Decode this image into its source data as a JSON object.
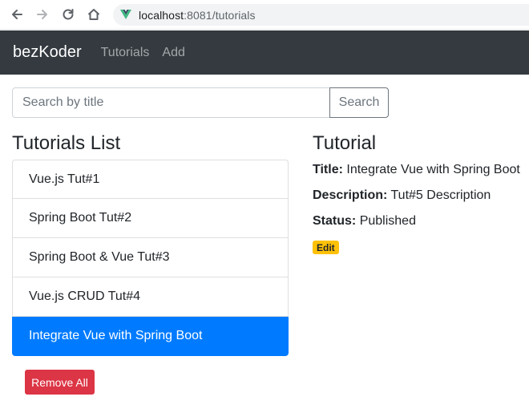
{
  "browser": {
    "url_host": "localhost",
    "url_rest_port": ":8081",
    "url_path": "/tutorials",
    "site_icon": "vue-logo-icon"
  },
  "navbar": {
    "brand": "bezKoder",
    "links": [
      "Tutorials",
      "Add"
    ]
  },
  "search": {
    "placeholder": "Search by title",
    "value": "",
    "button_label": "Search"
  },
  "list": {
    "title": "Tutorials List",
    "items": [
      "Vue.js Tut#1",
      "Spring Boot Tut#2",
      "Spring Boot & Vue Tut#3",
      "Vue.js CRUD Tut#4",
      "Integrate Vue with Spring Boot"
    ],
    "active_index": 4,
    "remove_all_label": "Remove All"
  },
  "detail": {
    "heading": "Tutorial",
    "title_label": "Title:",
    "title_value": "Integrate Vue with Spring Boot",
    "description_label": "Description:",
    "description_value": "Tut#5 Description",
    "status_label": "Status:",
    "status_value": "Published",
    "edit_label": "Edit"
  },
  "colors": {
    "navbar_bg": "#343a40",
    "active_item": "#007bff",
    "danger": "#dc3545",
    "warning": "#ffc107"
  }
}
